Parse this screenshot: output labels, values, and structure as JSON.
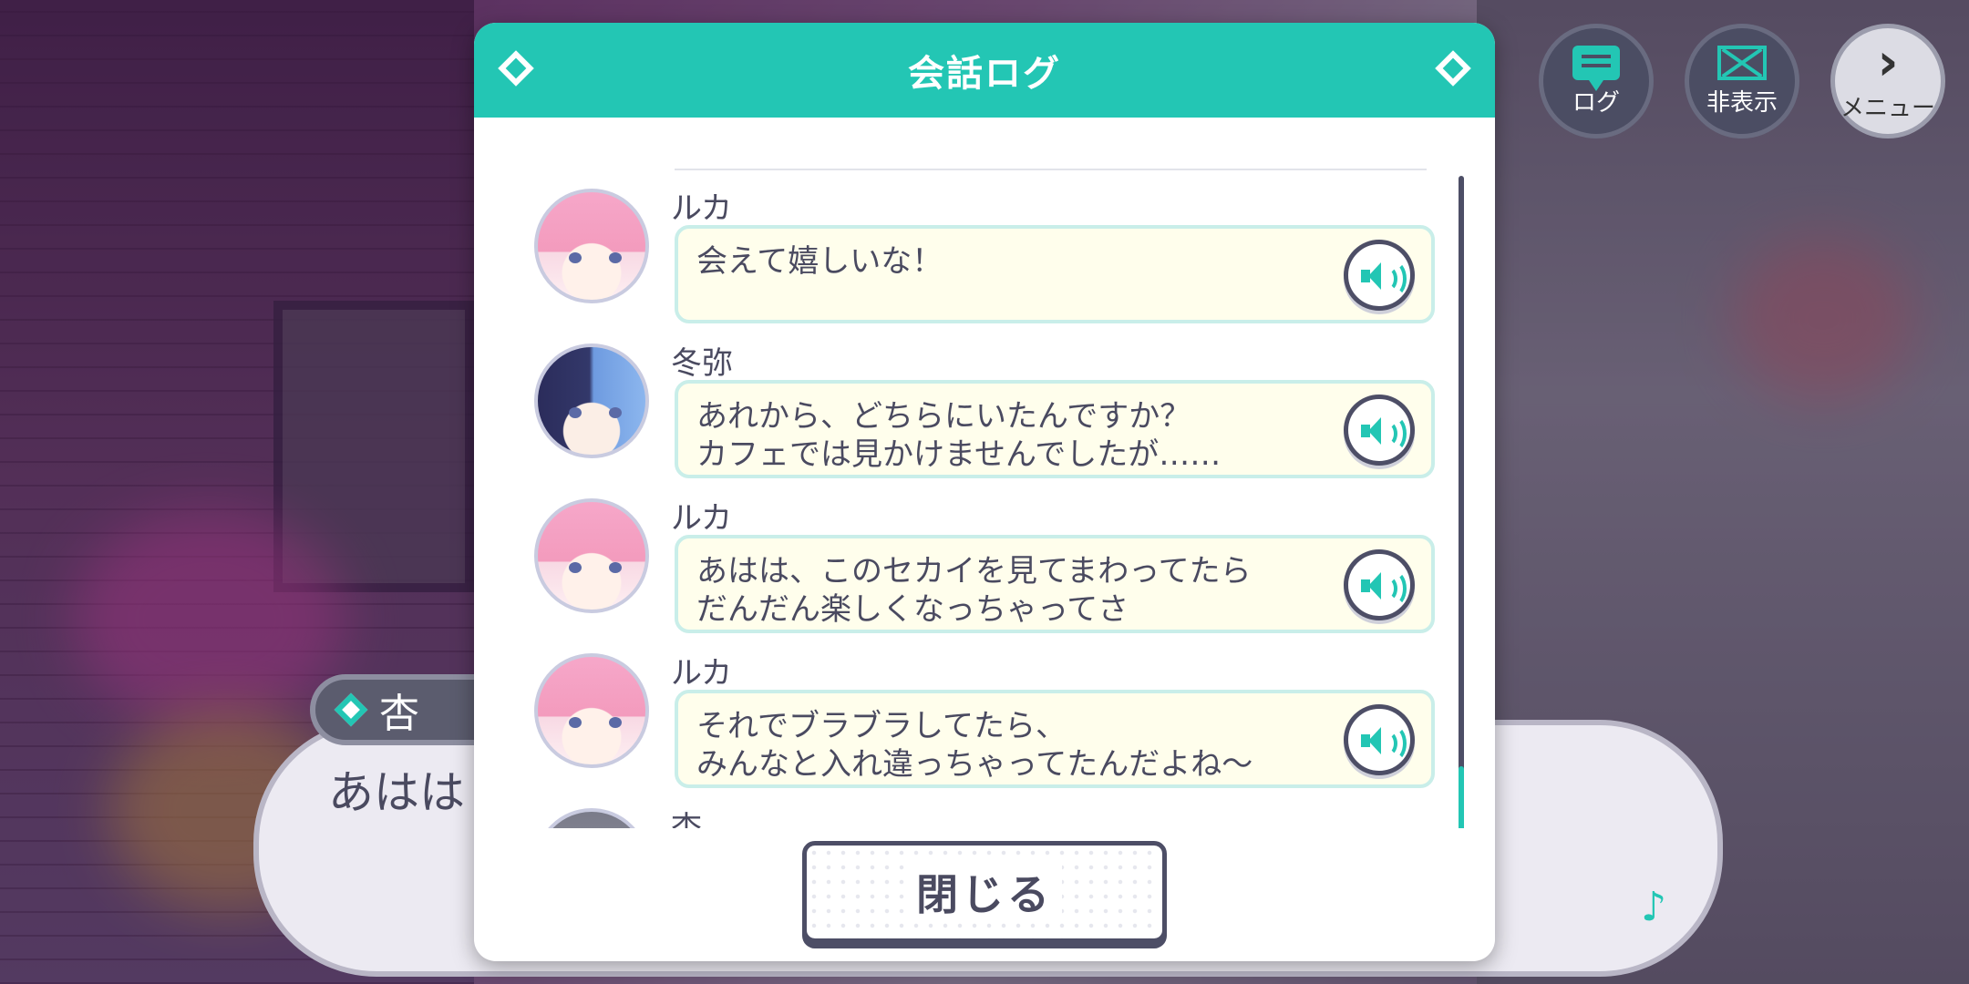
{
  "modal": {
    "title": "会話ログ",
    "close_label": "閉じる"
  },
  "log": [
    {
      "speaker": "ルカ",
      "lines": [
        "会えて嬉しいな！",
        ""
      ],
      "avatar": "luka"
    },
    {
      "speaker": "冬弥",
      "lines": [
        "あれから、どちらにいたんですか？",
        "カフェでは見かけませんでしたが……"
      ],
      "avatar": "toya"
    },
    {
      "speaker": "ルカ",
      "lines": [
        "あはは、このセカイを見てまわってたら",
        "だんだん楽しくなっちゃってさ"
      ],
      "avatar": "luka"
    },
    {
      "speaker": "ルカ",
      "lines": [
        "それでブラブラしてたら、",
        "みんなと入れ違っちゃってたんだよね～"
      ],
      "avatar": "luka"
    },
    {
      "speaker": "杏",
      "lines": [
        "",
        ""
      ],
      "avatar": "an"
    }
  ],
  "top_buttons": {
    "log": "ログ",
    "hide": "非表示",
    "menu": "メニュー"
  },
  "dialogue": {
    "speaker": "杏",
    "text": "あはは"
  },
  "colors": {
    "accent": "#23c6b4",
    "header": "#23c6b4",
    "bubble": "#fffeec",
    "dark": "#4d4e66"
  }
}
